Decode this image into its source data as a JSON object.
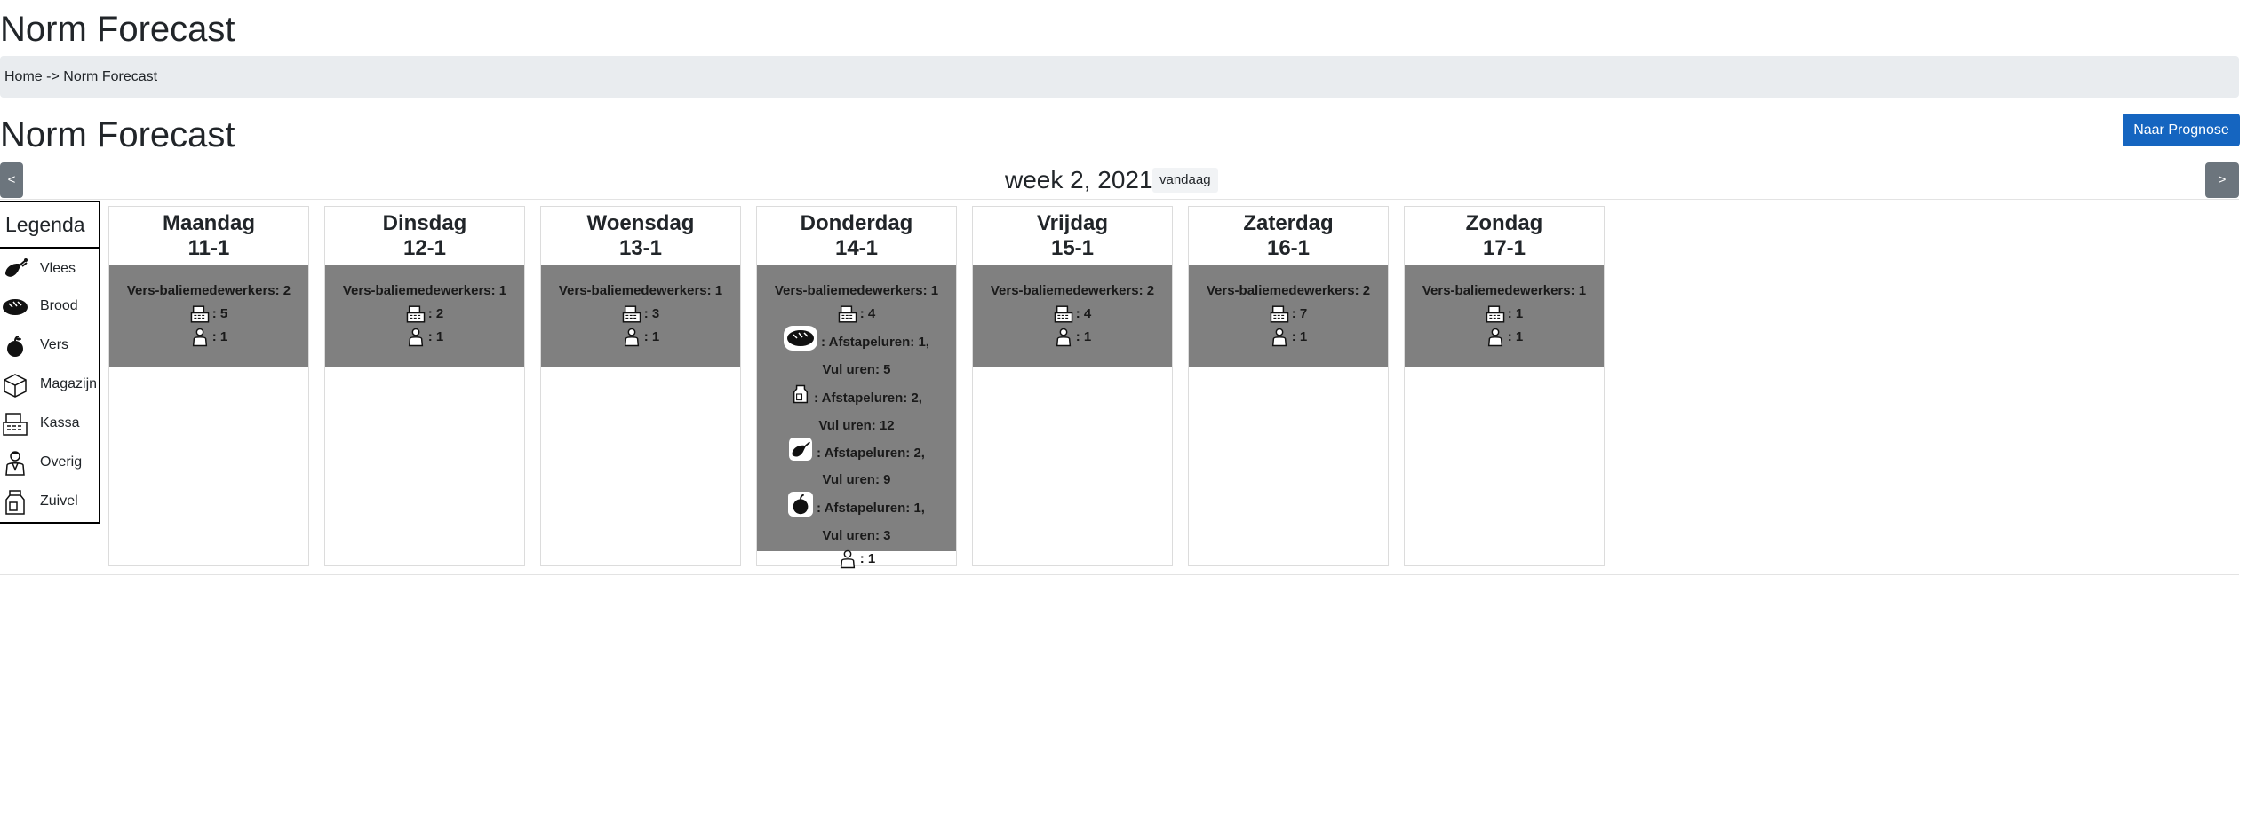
{
  "app_title": "Norm Forecast",
  "breadcrumb": {
    "home": "Home",
    "separator": "->",
    "current": "Norm Forecast"
  },
  "page_title": "Norm Forecast",
  "buttons": {
    "to_prognosis": "Naar Prognose",
    "prev": "<",
    "next": ">"
  },
  "week": {
    "label": "week 2, 2021",
    "today": "vandaag"
  },
  "legend": {
    "title": "Legenda",
    "items": [
      {
        "icon": "meat-icon",
        "label": "Vlees"
      },
      {
        "icon": "bread-icon",
        "label": "Brood"
      },
      {
        "icon": "apple-icon",
        "label": "Vers"
      },
      {
        "icon": "box-icon",
        "label": "Magazijn"
      },
      {
        "icon": "cash-register-icon",
        "label": "Kassa"
      },
      {
        "icon": "person-icon",
        "label": "Overig"
      },
      {
        "icon": "milk-carton-icon",
        "label": "Zuivel"
      }
    ]
  },
  "days": [
    {
      "name": "Maandag",
      "date": "11-1",
      "counter": "Vers-baliemedewerkers: 2",
      "kassa": ": 5",
      "overig": ": 1"
    },
    {
      "name": "Dinsdag",
      "date": "12-1",
      "counter": "Vers-baliemedewerkers: 1",
      "kassa": ": 2",
      "overig": ": 1"
    },
    {
      "name": "Woensdag",
      "date": "13-1",
      "counter": "Vers-baliemedewerkers: 1",
      "kassa": ": 3",
      "overig": ": 1"
    },
    {
      "name": "Donderdag",
      "date": "14-1",
      "counter": "Vers-baliemedewerkers: 1",
      "kassa": ": 4",
      "tasks": [
        {
          "icon": "bread-icon",
          "line1": ": Afstapeluren: 1,",
          "line2": "Vul uren: 5"
        },
        {
          "icon": "milk-carton-icon",
          "line1": ": Afstapeluren: 2,",
          "line2": "Vul uren: 12"
        },
        {
          "icon": "meat-icon",
          "line1": ": Afstapeluren: 2,",
          "line2": "Vul uren: 9"
        },
        {
          "icon": "apple-icon",
          "line1": ": Afstapeluren: 1,",
          "line2": "Vul uren: 3"
        }
      ],
      "overig": ": 1"
    },
    {
      "name": "Vrijdag",
      "date": "15-1",
      "counter": "Vers-baliemedewerkers: 2",
      "kassa": ": 4",
      "overig": ": 1"
    },
    {
      "name": "Zaterdag",
      "date": "16-1",
      "counter": "Vers-baliemedewerkers: 2",
      "kassa": ": 7",
      "overig": ": 1"
    },
    {
      "name": "Zondag",
      "date": "17-1",
      "counter": "Vers-baliemedewerkers: 1",
      "kassa": ": 1",
      "overig": ": 1"
    }
  ]
}
